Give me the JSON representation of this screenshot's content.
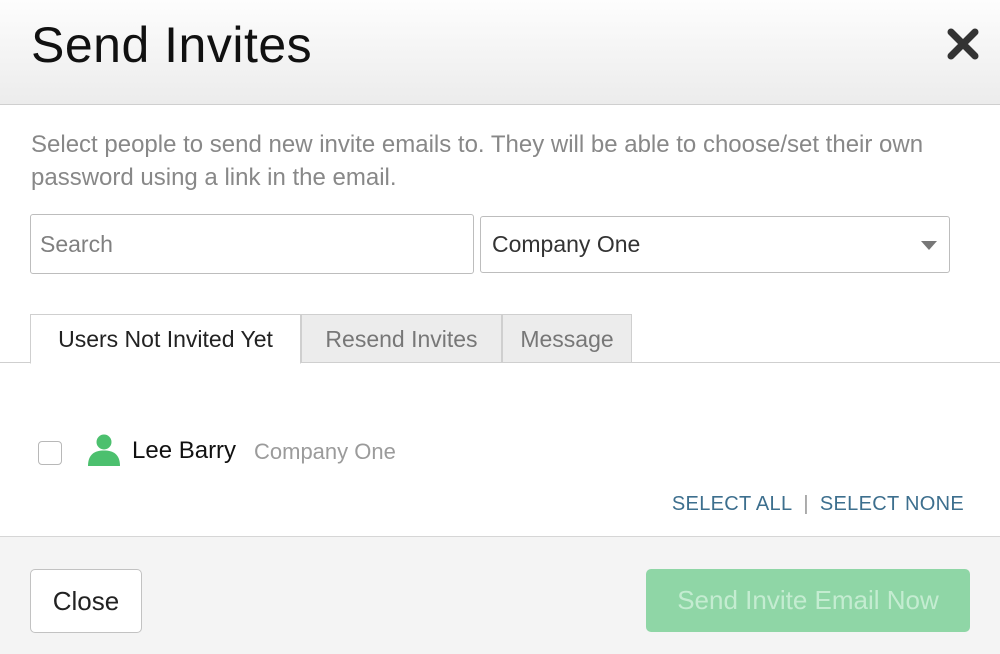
{
  "dialog": {
    "title": "Send Invites",
    "description": "Select people to send new invite emails to. They will be able to choose/set their own password using a link in the email."
  },
  "search": {
    "placeholder": "Search",
    "value": ""
  },
  "company_filter": {
    "selected": "Company One"
  },
  "tabs": [
    {
      "label": "Users Not Invited Yet",
      "active": true
    },
    {
      "label": "Resend Invites",
      "active": false
    },
    {
      "label": "Message",
      "active": false
    }
  ],
  "users": [
    {
      "name": "Lee Barry",
      "company": "Company One",
      "checked": false,
      "icon": "user-icon"
    }
  ],
  "selection": {
    "select_all": "SELECT ALL",
    "separator": "|",
    "select_none": "SELECT NONE"
  },
  "footer": {
    "close_label": "Close",
    "send_label": "Send Invite Email Now"
  },
  "colors": {
    "accent_green": "#8fd6a6",
    "avatar_green": "#4cc06e",
    "link_blue": "#3d6f8e"
  }
}
